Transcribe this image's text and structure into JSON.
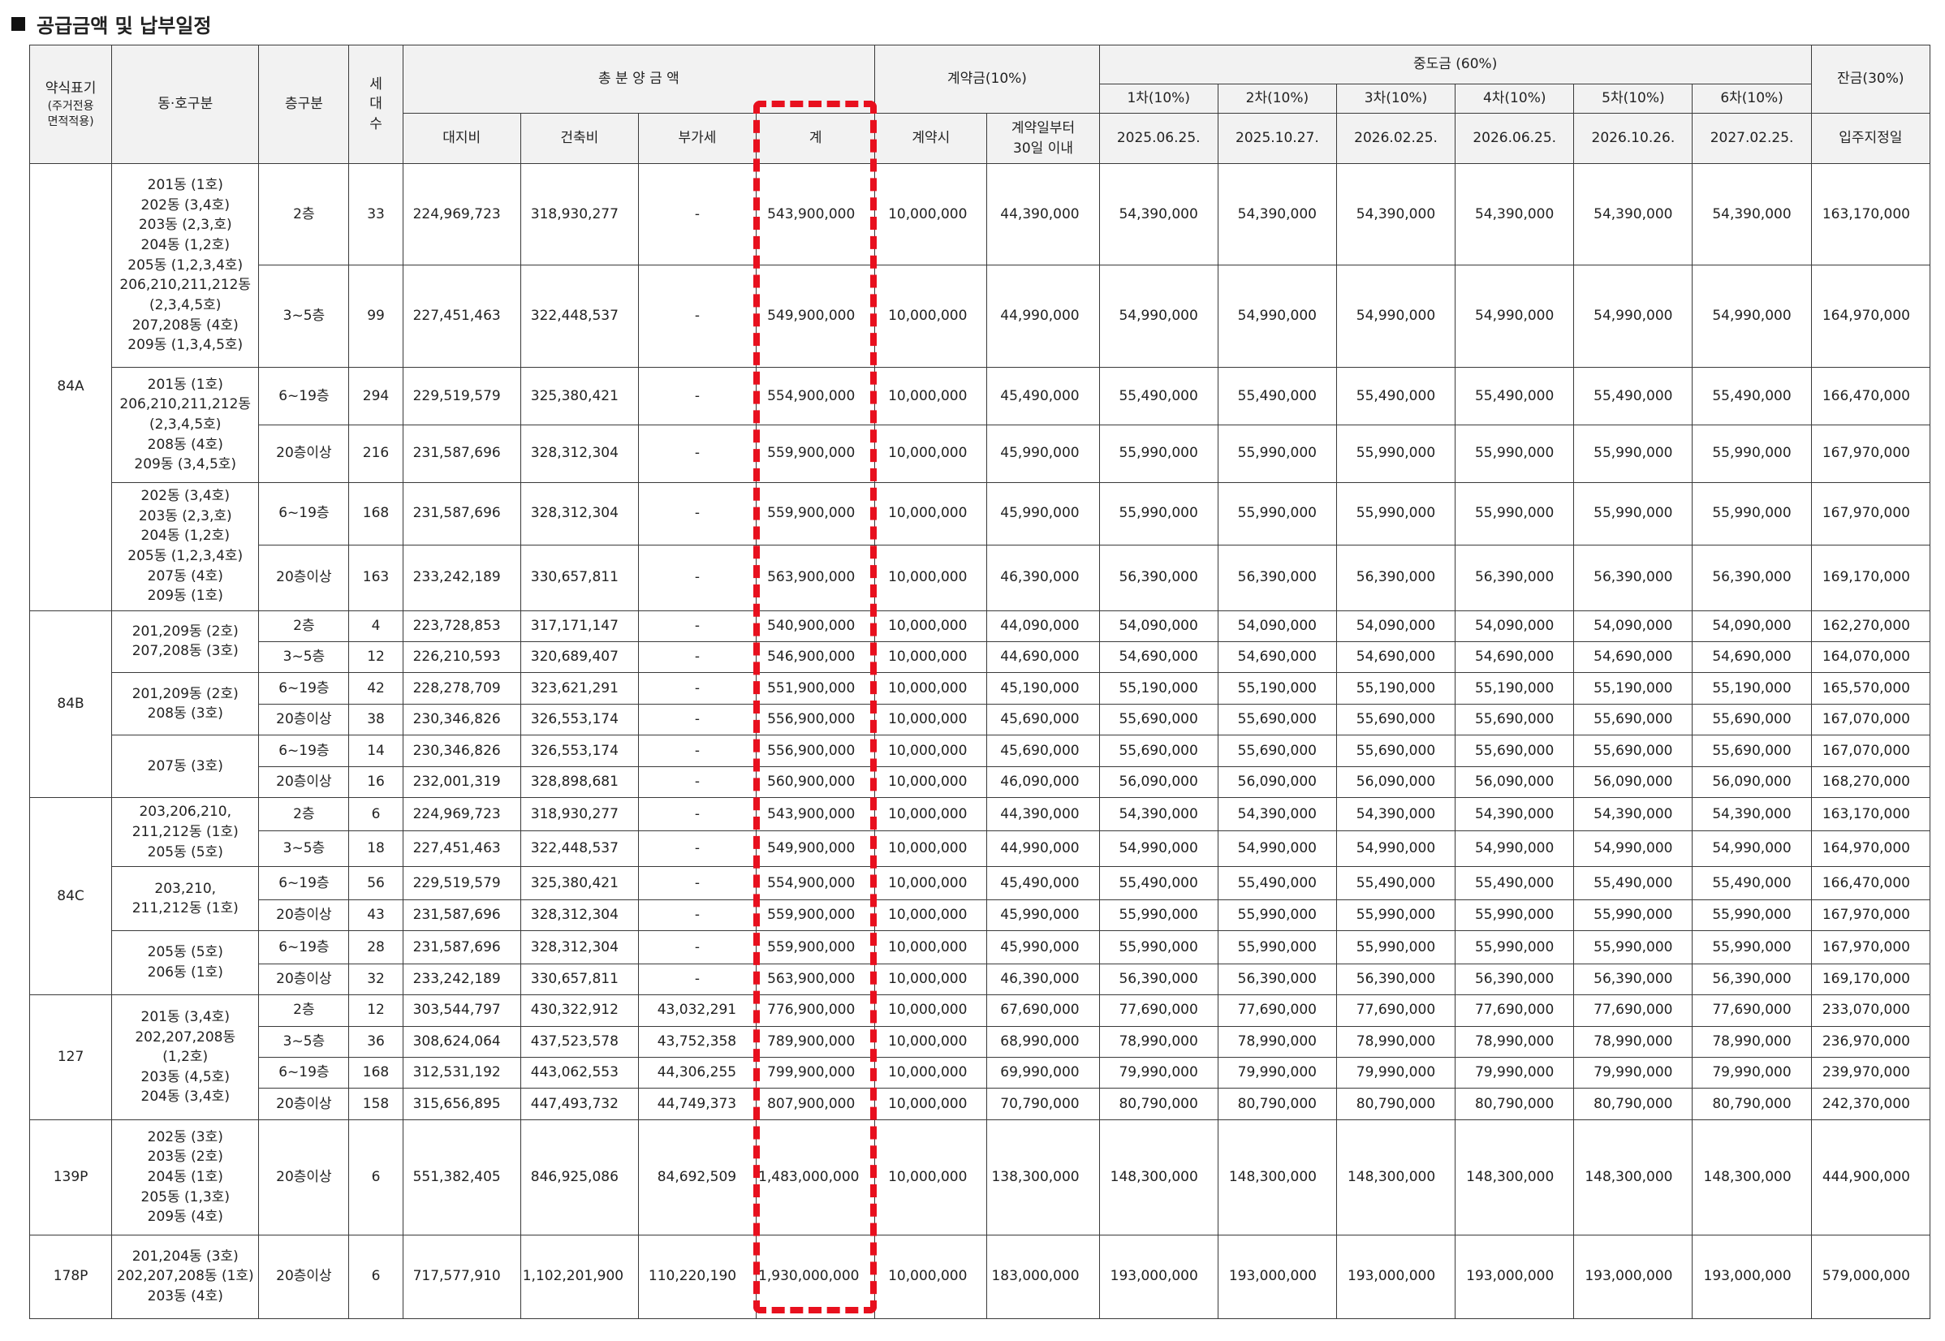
{
  "title": "공급금액 및 납부일정",
  "header": {
    "type_label": "약식표기",
    "type_note": "(주거전용\n면적적용)",
    "dong": "동·호구분",
    "floor": "층구분",
    "households": "세\n대\n수",
    "total": "총 분 양 금 액",
    "land": "대지비",
    "building": "건축비",
    "vat": "부가세",
    "sum": "계",
    "contract": "계약금(10%)",
    "contract_on": "계약시",
    "contract_30": "계약일부터\n30일 이내",
    "middle": "중도금 (60%)",
    "mid": [
      {
        "label": "1차(10%)",
        "date": "2025.06.25."
      },
      {
        "label": "2차(10%)",
        "date": "2025.10.27."
      },
      {
        "label": "3차(10%)",
        "date": "2026.02.25."
      },
      {
        "label": "4차(10%)",
        "date": "2026.06.25."
      },
      {
        "label": "5차(10%)",
        "date": "2026.10.26."
      },
      {
        "label": "6차(10%)",
        "date": "2027.02.25."
      }
    ],
    "balance": "잔금(30%)",
    "balance_date": "입주지정일"
  },
  "groups": [
    {
      "type": "84A",
      "blocks": [
        {
          "dong": "201동 (1호)\n202동 (3,4호)\n203동 (2,3,호)\n204동 (1,2호)\n205동 (1,2,3,4호)\n206,210,211,212동\n(2,3,4,5호)\n207,208동 (4호)\n209동 (1,3,4,5호)",
          "rows": [
            {
              "floor": "2층",
              "hh": "33",
              "land": "224,969,723",
              "build": "318,930,277",
              "vat": "-",
              "sum": "543,900,000",
              "c1": "10,000,000",
              "c2": "44,390,000",
              "m": [
                "54,390,000",
                "54,390,000",
                "54,390,000",
                "54,390,000",
                "54,390,000",
                "54,390,000"
              ],
              "bal": "163,170,000"
            },
            {
              "floor": "3~5층",
              "hh": "99",
              "land": "227,451,463",
              "build": "322,448,537",
              "vat": "-",
              "sum": "549,900,000",
              "c1": "10,000,000",
              "c2": "44,990,000",
              "m": [
                "54,990,000",
                "54,990,000",
                "54,990,000",
                "54,990,000",
                "54,990,000",
                "54,990,000"
              ],
              "bal": "164,970,000"
            }
          ]
        },
        {
          "dong": "201동 (1호)\n206,210,211,212동\n(2,3,4,5호)\n208동 (4호)\n209동 (3,4,5호)",
          "rows": [
            {
              "floor": "6~19층",
              "hh": "294",
              "land": "229,519,579",
              "build": "325,380,421",
              "vat": "-",
              "sum": "554,900,000",
              "c1": "10,000,000",
              "c2": "45,490,000",
              "m": [
                "55,490,000",
                "55,490,000",
                "55,490,000",
                "55,490,000",
                "55,490,000",
                "55,490,000"
              ],
              "bal": "166,470,000"
            },
            {
              "floor": "20층이상",
              "hh": "216",
              "land": "231,587,696",
              "build": "328,312,304",
              "vat": "-",
              "sum": "559,900,000",
              "c1": "10,000,000",
              "c2": "45,990,000",
              "m": [
                "55,990,000",
                "55,990,000",
                "55,990,000",
                "55,990,000",
                "55,990,000",
                "55,990,000"
              ],
              "bal": "167,970,000"
            }
          ]
        },
        {
          "dong": "202동 (3,4호)\n203동 (2,3,호)\n204동 (1,2호)\n205동 (1,2,3,4호)\n207동 (4호)\n209동 (1호)",
          "rows": [
            {
              "floor": "6~19층",
              "hh": "168",
              "land": "231,587,696",
              "build": "328,312,304",
              "vat": "-",
              "sum": "559,900,000",
              "c1": "10,000,000",
              "c2": "45,990,000",
              "m": [
                "55,990,000",
                "55,990,000",
                "55,990,000",
                "55,990,000",
                "55,990,000",
                "55,990,000"
              ],
              "bal": "167,970,000"
            },
            {
              "floor": "20층이상",
              "hh": "163",
              "land": "233,242,189",
              "build": "330,657,811",
              "vat": "-",
              "sum": "563,900,000",
              "c1": "10,000,000",
              "c2": "46,390,000",
              "m": [
                "56,390,000",
                "56,390,000",
                "56,390,000",
                "56,390,000",
                "56,390,000",
                "56,390,000"
              ],
              "bal": "169,170,000"
            }
          ]
        }
      ]
    },
    {
      "type": "84B",
      "blocks": [
        {
          "dong": "201,209동 (2호)\n207,208동 (3호)",
          "rows": [
            {
              "floor": "2층",
              "hh": "4",
              "land": "223,728,853",
              "build": "317,171,147",
              "vat": "-",
              "sum": "540,900,000",
              "c1": "10,000,000",
              "c2": "44,090,000",
              "m": [
                "54,090,000",
                "54,090,000",
                "54,090,000",
                "54,090,000",
                "54,090,000",
                "54,090,000"
              ],
              "bal": "162,270,000"
            },
            {
              "floor": "3~5층",
              "hh": "12",
              "land": "226,210,593",
              "build": "320,689,407",
              "vat": "-",
              "sum": "546,900,000",
              "c1": "10,000,000",
              "c2": "44,690,000",
              "m": [
                "54,690,000",
                "54,690,000",
                "54,690,000",
                "54,690,000",
                "54,690,000",
                "54,690,000"
              ],
              "bal": "164,070,000"
            }
          ]
        },
        {
          "dong": "201,209동 (2호)\n208동 (3호)",
          "rows": [
            {
              "floor": "6~19층",
              "hh": "42",
              "land": "228,278,709",
              "build": "323,621,291",
              "vat": "-",
              "sum": "551,900,000",
              "c1": "10,000,000",
              "c2": "45,190,000",
              "m": [
                "55,190,000",
                "55,190,000",
                "55,190,000",
                "55,190,000",
                "55,190,000",
                "55,190,000"
              ],
              "bal": "165,570,000"
            },
            {
              "floor": "20층이상",
              "hh": "38",
              "land": "230,346,826",
              "build": "326,553,174",
              "vat": "-",
              "sum": "556,900,000",
              "c1": "10,000,000",
              "c2": "45,690,000",
              "m": [
                "55,690,000",
                "55,690,000",
                "55,690,000",
                "55,690,000",
                "55,690,000",
                "55,690,000"
              ],
              "bal": "167,070,000"
            }
          ]
        },
        {
          "dong": "207동 (3호)",
          "rows": [
            {
              "floor": "6~19층",
              "hh": "14",
              "land": "230,346,826",
              "build": "326,553,174",
              "vat": "-",
              "sum": "556,900,000",
              "c1": "10,000,000",
              "c2": "45,690,000",
              "m": [
                "55,690,000",
                "55,690,000",
                "55,690,000",
                "55,690,000",
                "55,690,000",
                "55,690,000"
              ],
              "bal": "167,070,000"
            },
            {
              "floor": "20층이상",
              "hh": "16",
              "land": "232,001,319",
              "build": "328,898,681",
              "vat": "-",
              "sum": "560,900,000",
              "c1": "10,000,000",
              "c2": "46,090,000",
              "m": [
                "56,090,000",
                "56,090,000",
                "56,090,000",
                "56,090,000",
                "56,090,000",
                "56,090,000"
              ],
              "bal": "168,270,000"
            }
          ]
        }
      ]
    },
    {
      "type": "84C",
      "blocks": [
        {
          "dong": "203,206,210,\n211,212동 (1호)\n205동 (5호)",
          "rows": [
            {
              "floor": "2층",
              "hh": "6",
              "land": "224,969,723",
              "build": "318,930,277",
              "vat": "-",
              "sum": "543,900,000",
              "c1": "10,000,000",
              "c2": "44,390,000",
              "m": [
                "54,390,000",
                "54,390,000",
                "54,390,000",
                "54,390,000",
                "54,390,000",
                "54,390,000"
              ],
              "bal": "163,170,000"
            },
            {
              "floor": "3~5층",
              "hh": "18",
              "land": "227,451,463",
              "build": "322,448,537",
              "vat": "-",
              "sum": "549,900,000",
              "c1": "10,000,000",
              "c2": "44,990,000",
              "m": [
                "54,990,000",
                "54,990,000",
                "54,990,000",
                "54,990,000",
                "54,990,000",
                "54,990,000"
              ],
              "bal": "164,970,000"
            }
          ]
        },
        {
          "dong": "203,210,\n211,212동 (1호)",
          "rows": [
            {
              "floor": "6~19층",
              "hh": "56",
              "land": "229,519,579",
              "build": "325,380,421",
              "vat": "-",
              "sum": "554,900,000",
              "c1": "10,000,000",
              "c2": "45,490,000",
              "m": [
                "55,490,000",
                "55,490,000",
                "55,490,000",
                "55,490,000",
                "55,490,000",
                "55,490,000"
              ],
              "bal": "166,470,000"
            },
            {
              "floor": "20층이상",
              "hh": "43",
              "land": "231,587,696",
              "build": "328,312,304",
              "vat": "-",
              "sum": "559,900,000",
              "c1": "10,000,000",
              "c2": "45,990,000",
              "m": [
                "55,990,000",
                "55,990,000",
                "55,990,000",
                "55,990,000",
                "55,990,000",
                "55,990,000"
              ],
              "bal": "167,970,000"
            }
          ]
        },
        {
          "dong": "205동 (5호)\n206동 (1호)",
          "rows": [
            {
              "floor": "6~19층",
              "hh": "28",
              "land": "231,587,696",
              "build": "328,312,304",
              "vat": "-",
              "sum": "559,900,000",
              "c1": "10,000,000",
              "c2": "45,990,000",
              "m": [
                "55,990,000",
                "55,990,000",
                "55,990,000",
                "55,990,000",
                "55,990,000",
                "55,990,000"
              ],
              "bal": "167,970,000"
            },
            {
              "floor": "20층이상",
              "hh": "32",
              "land": "233,242,189",
              "build": "330,657,811",
              "vat": "-",
              "sum": "563,900,000",
              "c1": "10,000,000",
              "c2": "46,390,000",
              "m": [
                "56,390,000",
                "56,390,000",
                "56,390,000",
                "56,390,000",
                "56,390,000",
                "56,390,000"
              ],
              "bal": "169,170,000"
            }
          ]
        }
      ]
    },
    {
      "type": "127",
      "blocks": [
        {
          "dong": "201동 (3,4호)\n202,207,208동\n(1,2호)\n203동 (4,5호)\n204동 (3,4호)",
          "rows": [
            {
              "floor": "2층",
              "hh": "12",
              "land": "303,544,797",
              "build": "430,322,912",
              "vat": "43,032,291",
              "sum": "776,900,000",
              "c1": "10,000,000",
              "c2": "67,690,000",
              "m": [
                "77,690,000",
                "77,690,000",
                "77,690,000",
                "77,690,000",
                "77,690,000",
                "77,690,000"
              ],
              "bal": "233,070,000"
            },
            {
              "floor": "3~5층",
              "hh": "36",
              "land": "308,624,064",
              "build": "437,523,578",
              "vat": "43,752,358",
              "sum": "789,900,000",
              "c1": "10,000,000",
              "c2": "68,990,000",
              "m": [
                "78,990,000",
                "78,990,000",
                "78,990,000",
                "78,990,000",
                "78,990,000",
                "78,990,000"
              ],
              "bal": "236,970,000"
            },
            {
              "floor": "6~19층",
              "hh": "168",
              "land": "312,531,192",
              "build": "443,062,553",
              "vat": "44,306,255",
              "sum": "799,900,000",
              "c1": "10,000,000",
              "c2": "69,990,000",
              "m": [
                "79,990,000",
                "79,990,000",
                "79,990,000",
                "79,990,000",
                "79,990,000",
                "79,990,000"
              ],
              "bal": "239,970,000"
            },
            {
              "floor": "20층이상",
              "hh": "158",
              "land": "315,656,895",
              "build": "447,493,732",
              "vat": "44,749,373",
              "sum": "807,900,000",
              "c1": "10,000,000",
              "c2": "70,790,000",
              "m": [
                "80,790,000",
                "80,790,000",
                "80,790,000",
                "80,790,000",
                "80,790,000",
                "80,790,000"
              ],
              "bal": "242,370,000"
            }
          ]
        }
      ]
    },
    {
      "type": "139P",
      "blocks": [
        {
          "dong": "202동 (3호)\n203동 (2호)\n204동 (1호)\n205동 (1,3호)\n209동 (4호)",
          "rows": [
            {
              "floor": "20층이상",
              "hh": "6",
              "land": "551,382,405",
              "build": "846,925,086",
              "vat": "84,692,509",
              "sum": "1,483,000,000",
              "c1": "10,000,000",
              "c2": "138,300,000",
              "m": [
                "148,300,000",
                "148,300,000",
                "148,300,000",
                "148,300,000",
                "148,300,000",
                "148,300,000"
              ],
              "bal": "444,900,000"
            }
          ]
        }
      ]
    },
    {
      "type": "178P",
      "blocks": [
        {
          "dong": "201,204동 (3호)\n202,207,208동 (1호)\n203동 (4호)",
          "rows": [
            {
              "floor": "20층이상",
              "hh": "6",
              "land": "717,577,910",
              "build": "1,102,201,900",
              "vat": "110,220,190",
              "sum": "1,930,000,000",
              "c1": "10,000,000",
              "c2": "183,000,000",
              "m": [
                "193,000,000",
                "193,000,000",
                "193,000,000",
                "193,000,000",
                "193,000,000",
                "193,000,000"
              ],
              "bal": "579,000,000"
            }
          ]
        }
      ]
    }
  ],
  "highlight_color": "#e8101e"
}
